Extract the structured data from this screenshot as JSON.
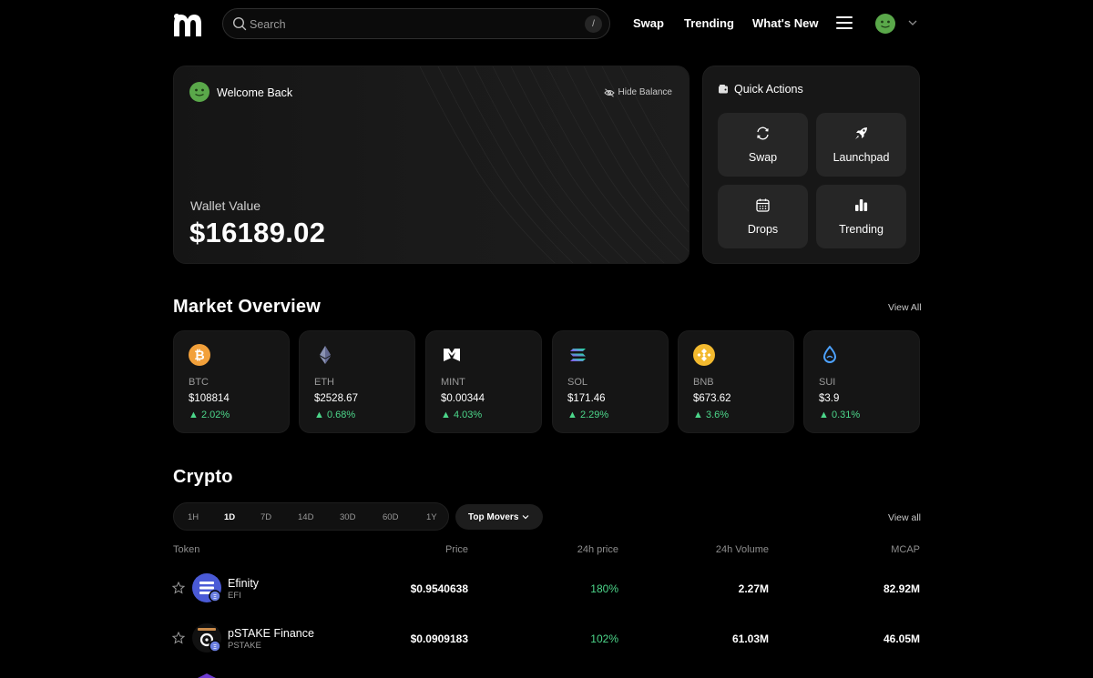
{
  "nav": {
    "logo_icon": "brand-m-icon",
    "search_placeholder": "Search",
    "search_shortcut": "/",
    "links": [
      "Swap",
      "Trending",
      "What's New"
    ],
    "menu_icon": "hamburger-icon",
    "avatar_icon": "smiley-avatar-icon",
    "chevron_icon": "chevron-down-icon"
  },
  "welcome": {
    "title": "Welcome Back",
    "hide_balance": "Hide Balance",
    "wallet_label": "Wallet Value",
    "wallet_value": "$16189.02"
  },
  "quick_actions": {
    "title": "Quick Actions",
    "buttons": [
      {
        "label": "Swap",
        "icon": "refresh-icon"
      },
      {
        "label": "Launchpad",
        "icon": "rocket-icon"
      },
      {
        "label": "Drops",
        "icon": "calendar-icon"
      },
      {
        "label": "Trending",
        "icon": "bar-chart-icon"
      }
    ]
  },
  "market": {
    "title": "Market Overview",
    "view_all": "View All",
    "coins": [
      {
        "symbol": "BTC",
        "price": "$108814",
        "change": "2.02%",
        "icon": "bitcoin-icon"
      },
      {
        "symbol": "ETH",
        "price": "$2528.67",
        "change": "0.68%",
        "icon": "ethereum-icon"
      },
      {
        "symbol": "MINT",
        "price": "$0.00344",
        "change": "4.03%",
        "icon": "mint-icon"
      },
      {
        "symbol": "SOL",
        "price": "$171.46",
        "change": "2.29%",
        "icon": "solana-icon"
      },
      {
        "symbol": "BNB",
        "price": "$673.62",
        "change": "3.6%",
        "icon": "bnb-icon"
      },
      {
        "symbol": "SUI",
        "price": "$3.9",
        "change": "0.31%",
        "icon": "sui-icon"
      }
    ]
  },
  "crypto": {
    "title": "Crypto",
    "timeframes": [
      "1H",
      "1D",
      "7D",
      "14D",
      "30D",
      "60D",
      "1Y"
    ],
    "active_timeframe": "1D",
    "filter": "Top Movers",
    "view_all": "View all",
    "columns": [
      "Token",
      "Price",
      "24h price",
      "24h Volume",
      "MCAP"
    ],
    "rows": [
      {
        "name": "Efinity",
        "symbol": "EFI",
        "price": "$0.9540638",
        "change": "180%",
        "volume": "2.27M",
        "mcap": "82.92M",
        "icon": "efinity-icon"
      },
      {
        "name": "pSTAKE Finance",
        "symbol": "PSTAKE",
        "price": "$0.0909183",
        "change": "102%",
        "volume": "61.03M",
        "mcap": "46.05M",
        "icon": "pstake-icon"
      }
    ]
  },
  "colors": {
    "background": "#000000",
    "card": "#151515",
    "positive": "#4cd68a",
    "avatar_green": "#5aa84a"
  }
}
